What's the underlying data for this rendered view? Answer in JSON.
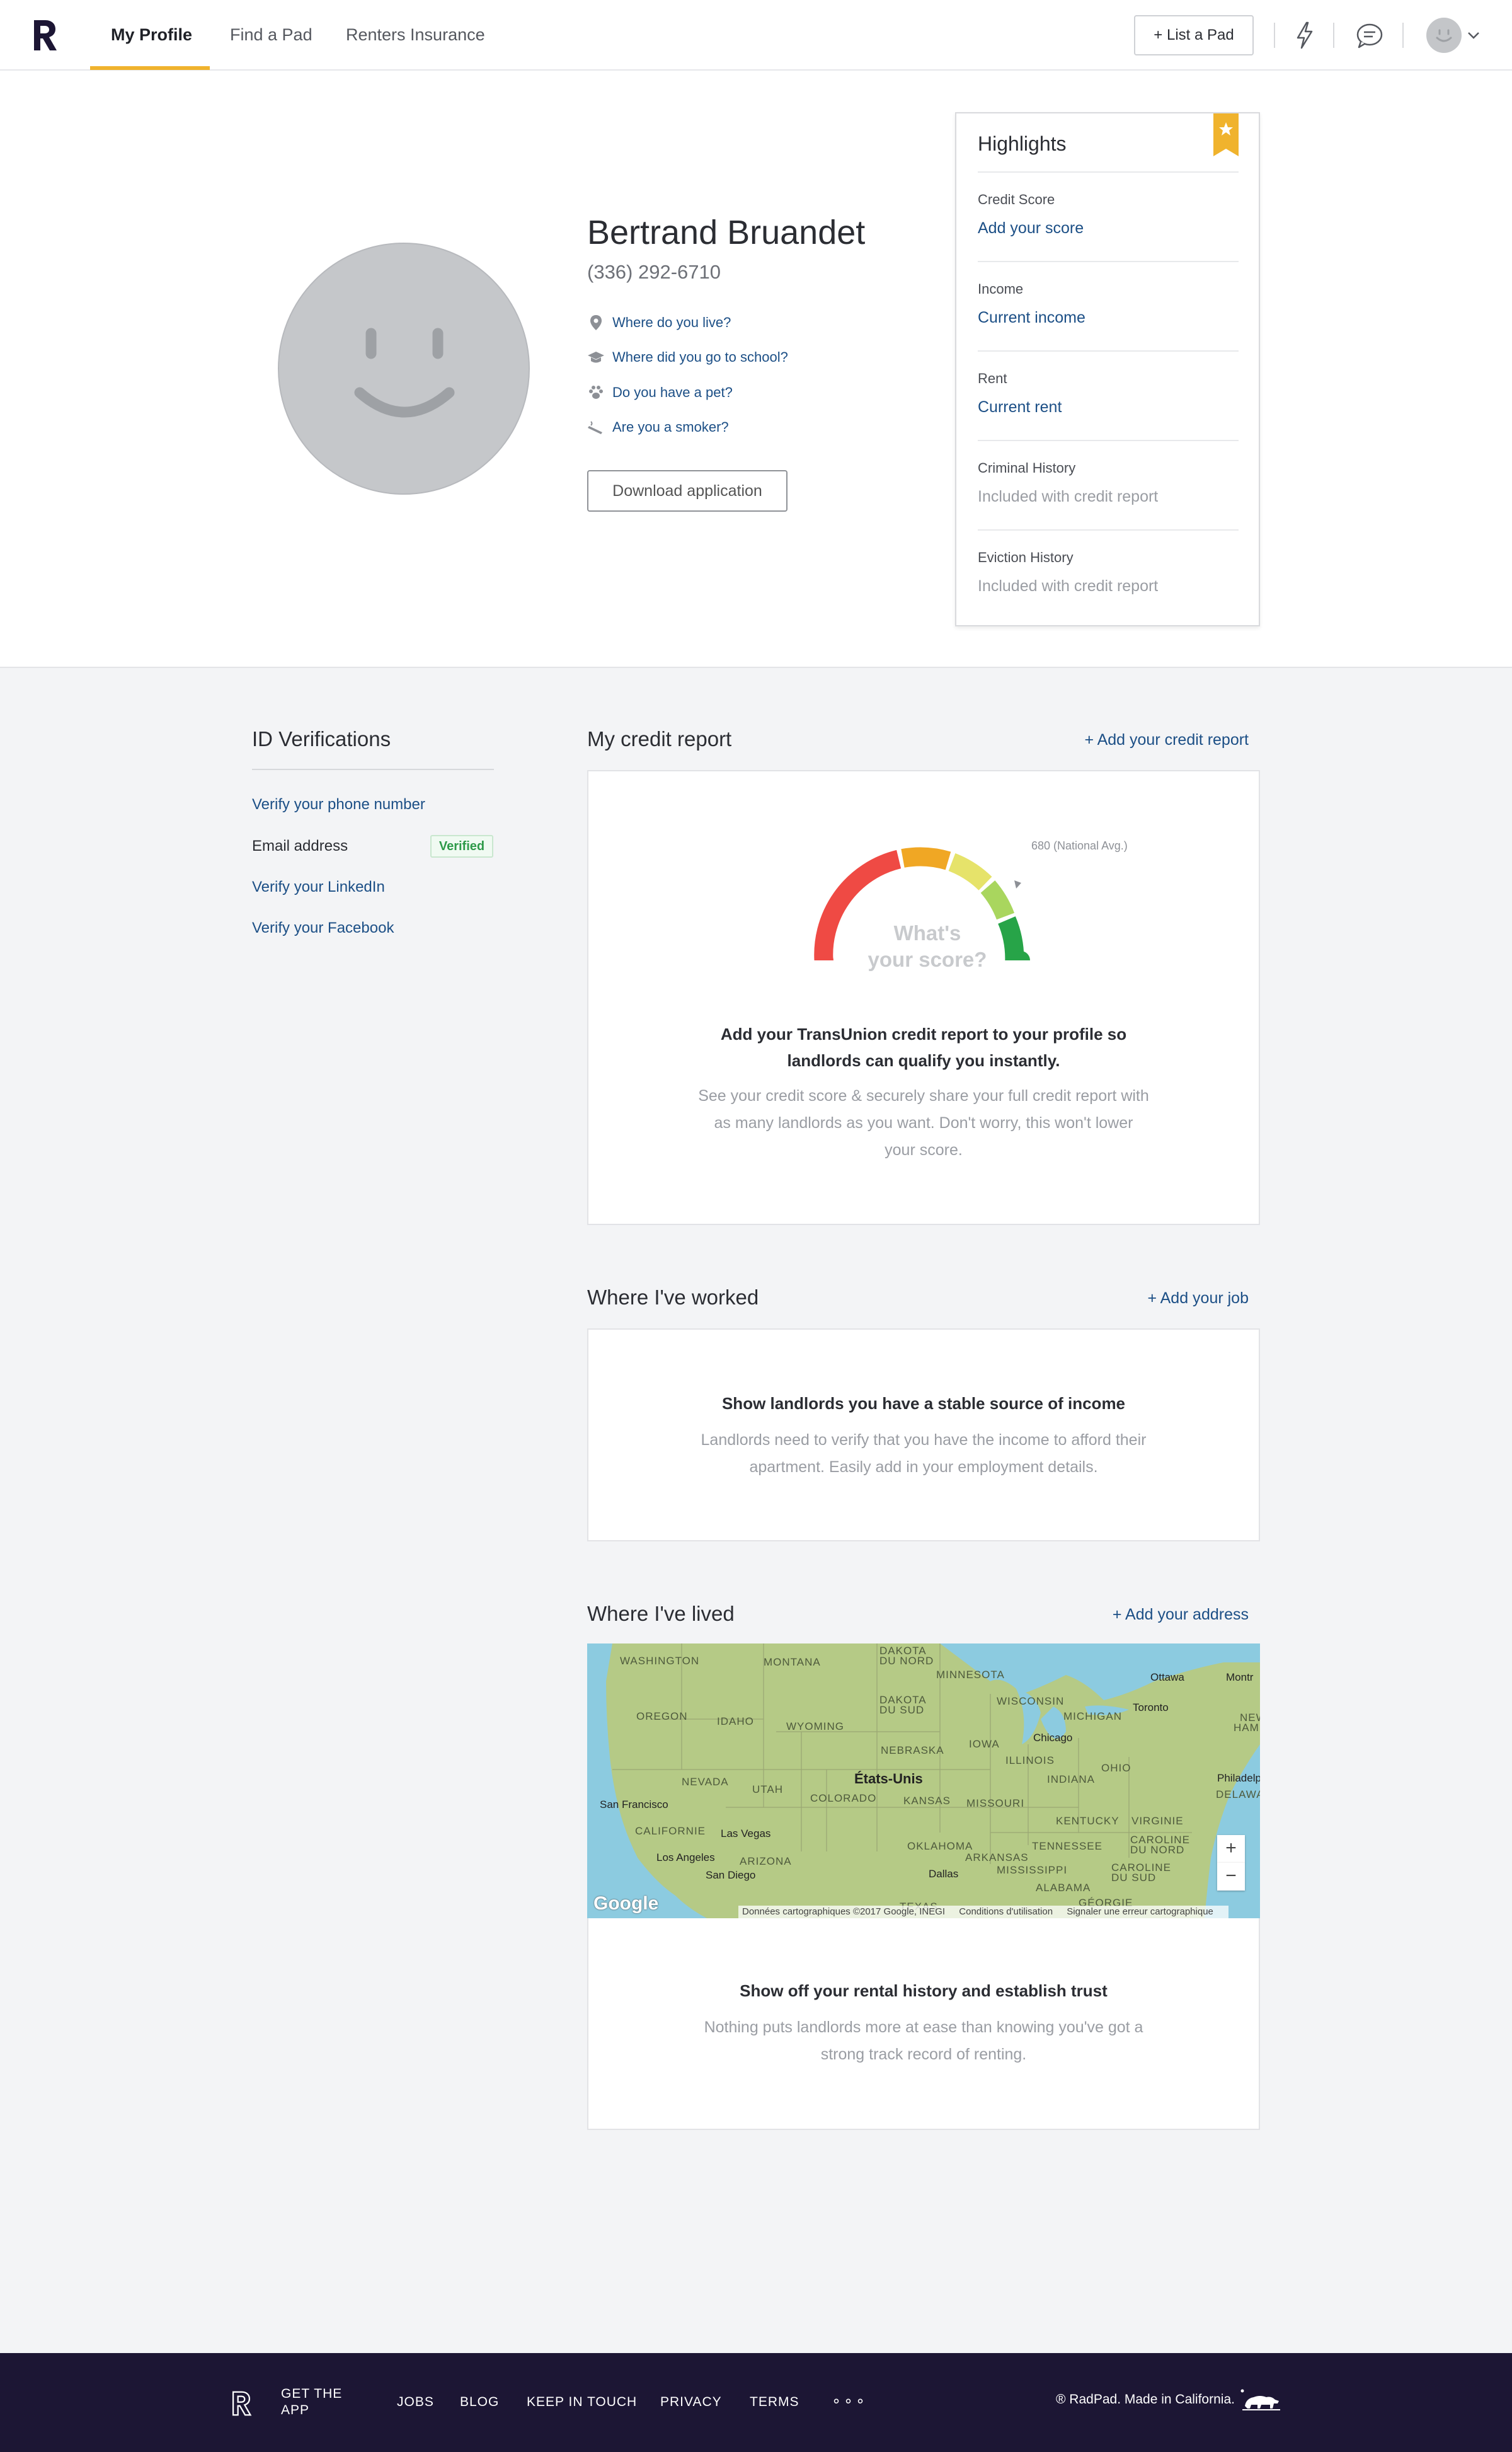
{
  "header": {
    "nav": [
      {
        "label": "My Profile"
      },
      {
        "label": "Find a Pad"
      },
      {
        "label": "Renters Insurance"
      }
    ],
    "list_pad_label": "+ List a Pad"
  },
  "profile": {
    "name": "Bertrand Bruandet",
    "phone": "(336) 292-6710",
    "questions": [
      {
        "label": "Where do you live?",
        "icon": "location-pin-icon"
      },
      {
        "label": "Where did you go to school?",
        "icon": "graduation-cap-icon"
      },
      {
        "label": "Do you have a pet?",
        "icon": "paw-icon"
      },
      {
        "label": "Are you a smoker?",
        "icon": "cigarette-icon"
      }
    ],
    "download_label": "Download application"
  },
  "highlights": {
    "title": "Highlights",
    "rows": [
      {
        "label": "Credit Score",
        "value": "Add your score"
      },
      {
        "label": "Income",
        "value": "Current income"
      },
      {
        "label": "Rent",
        "value": "Current rent"
      },
      {
        "label": "Criminal History",
        "value": "Included with credit report"
      },
      {
        "label": "Eviction History",
        "value": "Included with credit report"
      }
    ]
  },
  "id_verifications": {
    "title": "ID Verifications",
    "items": [
      {
        "label": "Verify your phone number"
      },
      {
        "label": "Email address",
        "badge": "Verified"
      },
      {
        "label": "Verify your LinkedIn"
      },
      {
        "label": "Verify your Facebook"
      }
    ]
  },
  "credit": {
    "title": "My credit report",
    "add_link": "+ Add your credit report",
    "gauge_label": "680 (National Avg.)",
    "gauge_center_line1": "What's",
    "gauge_center_line2": "your score?",
    "headline_line1": "Add your TransUnion credit report to your profile so",
    "headline_line2": "landlords can qualify you instantly.",
    "body_line1": "See your credit score & securely share your full credit report with",
    "body_line2": "as many landlords as you want. Don't worry, this won't lower",
    "body_line3": "your score.",
    "colors": {
      "red": "#ef4a44",
      "orange": "#f0a724",
      "yellow": "#e6e36a",
      "lightgreen": "#a9d65e",
      "green": "#27a448"
    }
  },
  "worked": {
    "title": "Where I've worked",
    "add_link": "+ Add your job",
    "headline": "Show landlords you have a stable source of income",
    "body_line1": "Landlords need to verify that you have the income to afford their",
    "body_line2": "apartment. Easily add in your employment details."
  },
  "lived": {
    "title": "Where I've lived",
    "add_link": "+ Add your address",
    "headline": "Show off your rental history and establish trust",
    "body_line1": "Nothing puts landlords more at ease than knowing you've got a",
    "body_line2": "strong track record of renting.",
    "map": {
      "country": "États-Unis",
      "states": [
        "WASHINGTON",
        "MONTANA",
        "DAKOTA",
        "DU NORD",
        "MINNESOTA",
        "OREGON",
        "IDAHO",
        "DAKOTA",
        "DU SUD",
        "WISCONSIN",
        "MICHIGAN",
        "WYOMING",
        "IOWA",
        "NEBRASKA",
        "NEVADA",
        "UTAH",
        "ILLINOIS",
        "INDIANA",
        "OHIO",
        "COLORADO",
        "KANSAS",
        "MISSOURI",
        "CALIFORNIE",
        "KENTUCKY",
        "VIRGINIE",
        "ARIZONA",
        "OKLAHOMA",
        "TENNESSEE",
        "CAROLINE",
        "DU NORD",
        "ARKANSAS",
        "CAROLINE",
        "DU SUD",
        "MISSISSIPPI",
        "ALABAMA",
        "DELAWARE"
      ],
      "cities": [
        "Ottawa",
        "Montr",
        "Toronto",
        "Chicago",
        "NEW",
        "HAMPSH",
        "Philadelphi",
        "San Francisco",
        "Las Vegas",
        "Los Angeles",
        "San Diego",
        "Dallas",
        "GÉORGIE",
        "TEXAS"
      ],
      "zoom_in": "+",
      "zoom_out": "−",
      "google": "Google",
      "attribution": "Données cartographiques ©2017 Google, INEGI",
      "terms": "Conditions d'utilisation",
      "report": "Signaler une erreur cartographique"
    }
  },
  "footer": {
    "get_app_line1": "GET THE",
    "get_app_line2": "APP",
    "links": [
      "JOBS",
      "BLOG",
      "KEEP IN TOUCH",
      "PRIVACY",
      "TERMS"
    ],
    "more": "∘∘∘",
    "copyright": "® RadPad. Made in California."
  }
}
